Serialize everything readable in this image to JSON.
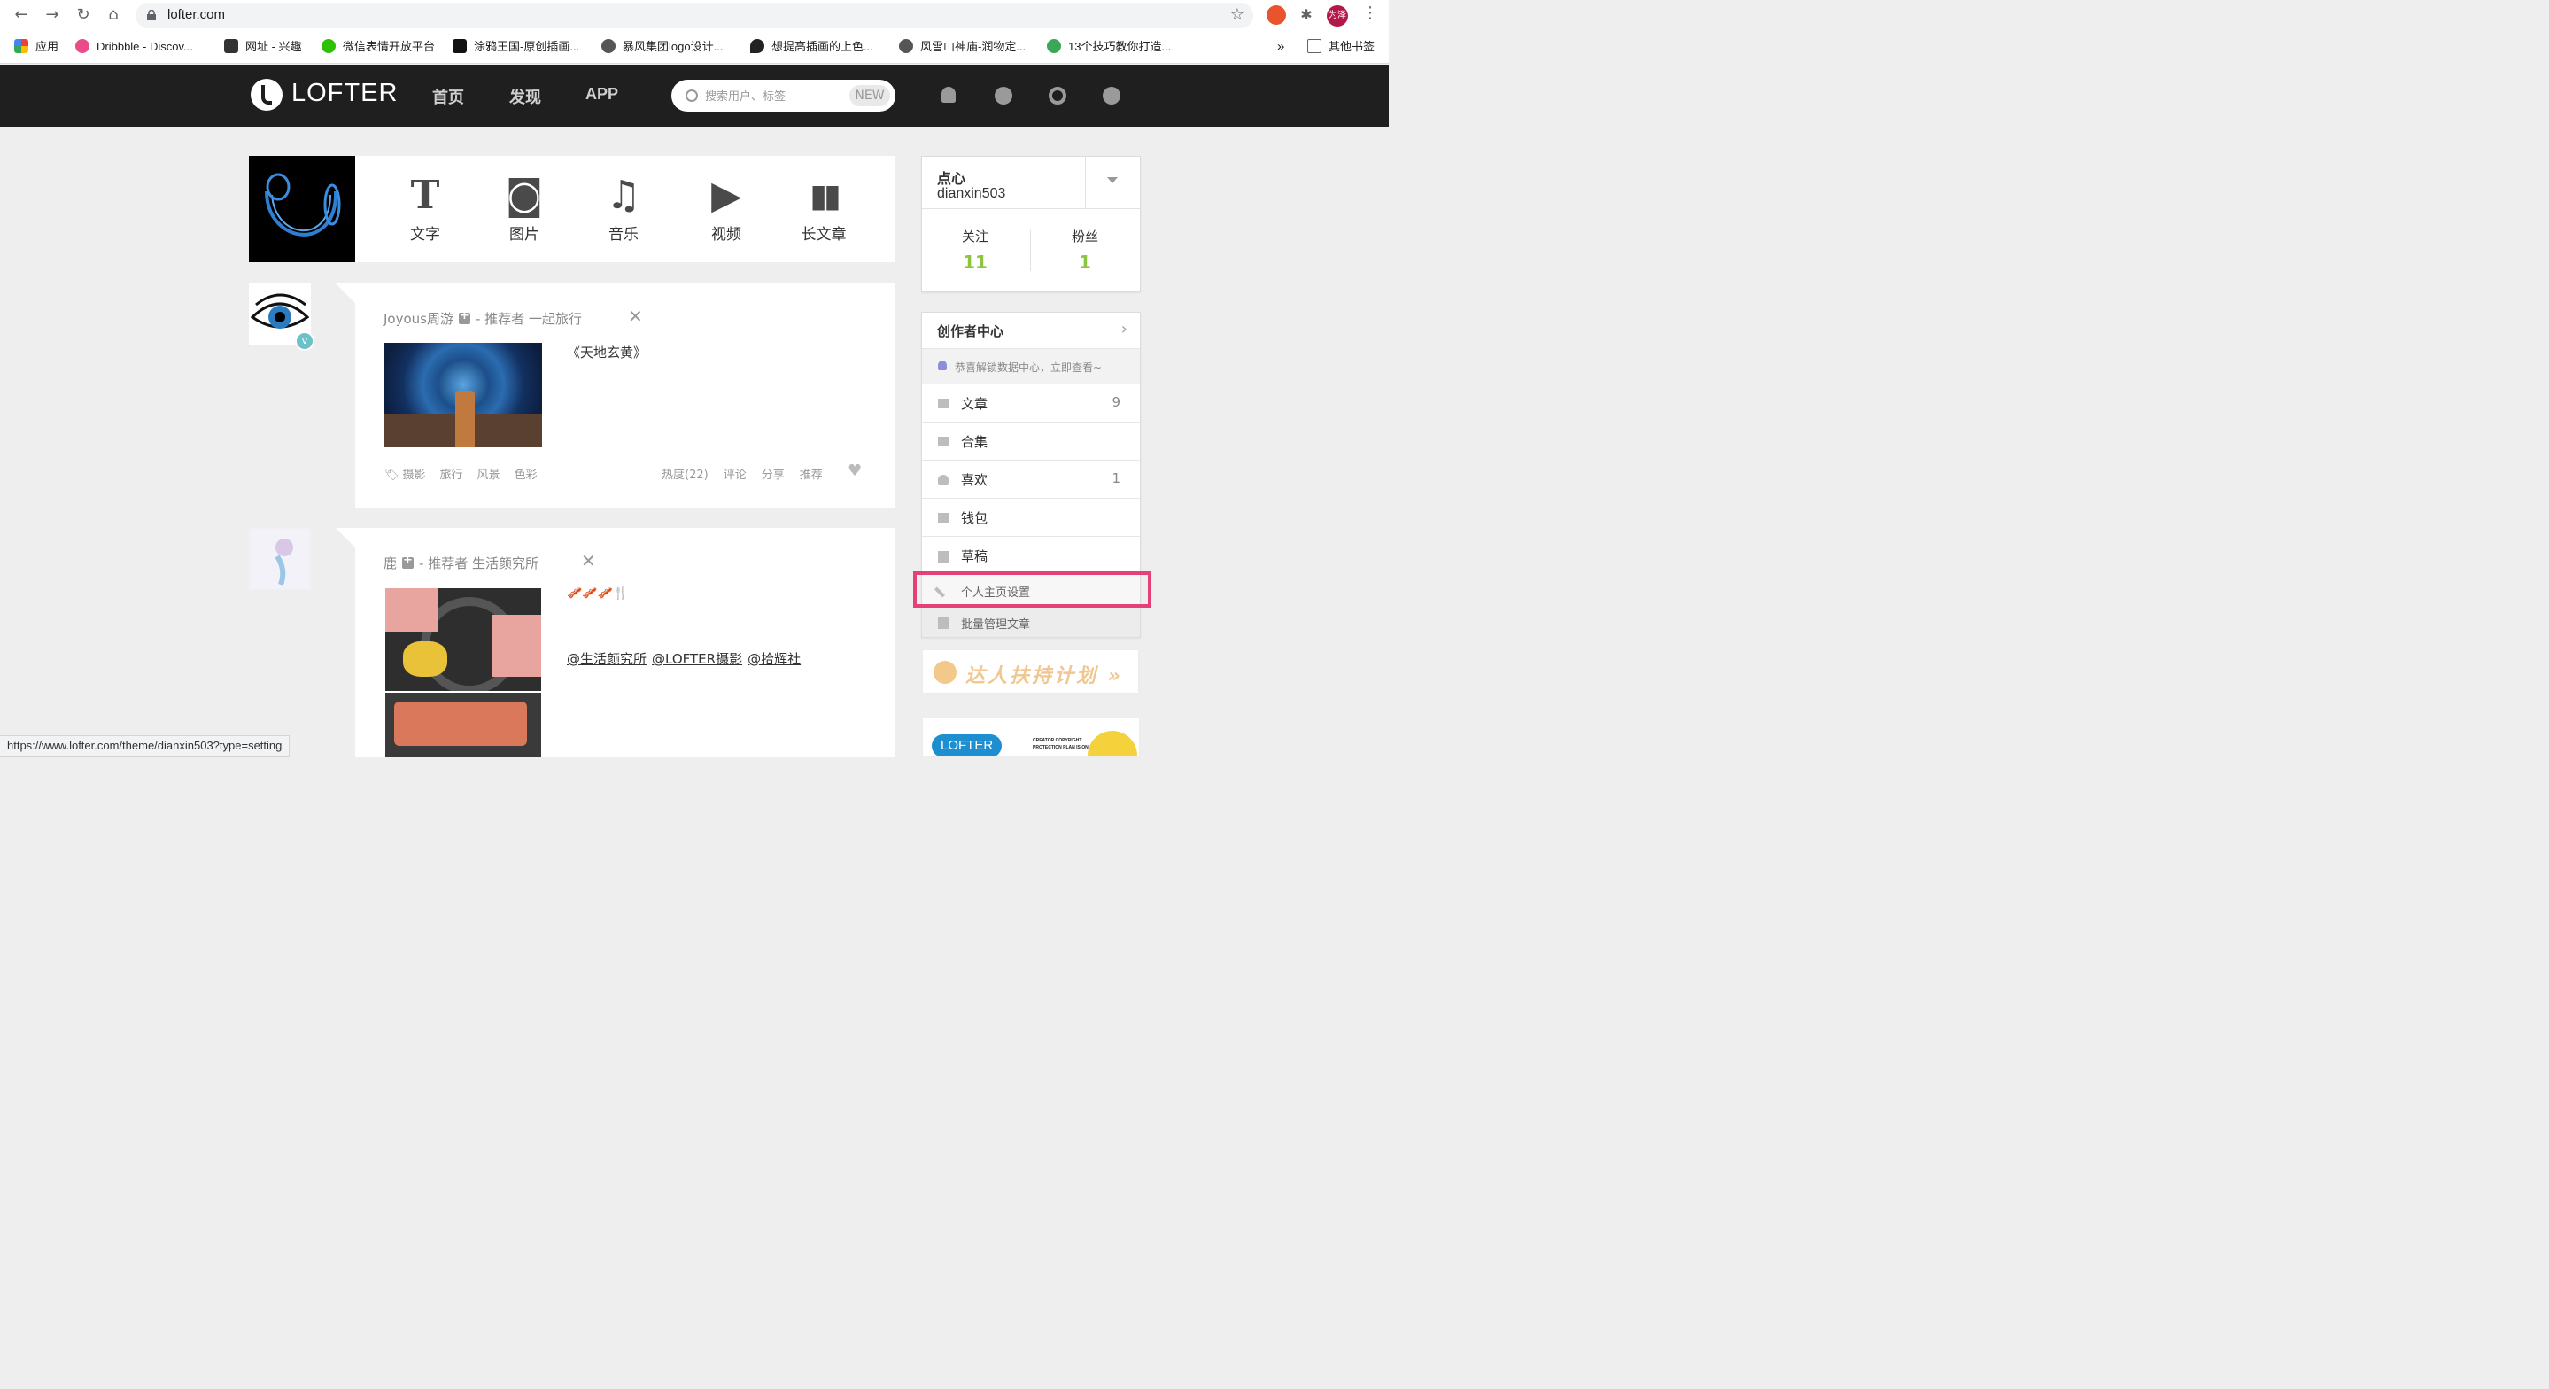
{
  "browser": {
    "url": "lofter.com",
    "status_url": "https://www.lofter.com/theme/dianxin503?type=setting",
    "profile_label": "为泽",
    "bookmarks": [
      {
        "label": "应用",
        "color": "#e84c3d"
      },
      {
        "label": "Dribbble - Discov...",
        "color": "#ea4c89"
      },
      {
        "label": "网址 - 兴趣",
        "color": "#333333"
      },
      {
        "label": "微信表情开放平台",
        "color": "#2dc100"
      },
      {
        "label": "涂鸦王国-原创插画...",
        "color": "#111111"
      },
      {
        "label": "暴风集团logo设计...",
        "color": "#555555"
      },
      {
        "label": "想提高插画的上色...",
        "color": "#222222"
      },
      {
        "label": "风雪山神庙-润物定...",
        "color": "#555555"
      },
      {
        "label": "13个技巧教你打造...",
        "color": "#3aa757"
      }
    ],
    "more_bookmarks": "»",
    "other_bookmarks": "其他书签"
  },
  "header": {
    "logo_text": "LOFTER",
    "nav": [
      "首页",
      "发现",
      "APP"
    ],
    "search_placeholder": "搜索用户、标签",
    "search_badge": "NEW"
  },
  "post_types": [
    {
      "label": "文字",
      "glyph": "T"
    },
    {
      "label": "图片",
      "glyph": "◙"
    },
    {
      "label": "音乐",
      "glyph": "♫"
    },
    {
      "label": "视频",
      "glyph": "▶"
    },
    {
      "label": "长文章",
      "glyph": "▮▮"
    }
  ],
  "posts": [
    {
      "author": "Joyous周游",
      "recommender_prefix": "- 推荐者",
      "recommender": "一起旅行",
      "title": "《天地玄黄》",
      "tags": [
        "摄影",
        "旅行",
        "风景",
        "色彩"
      ],
      "actions": [
        "热度(22)",
        "评论",
        "分享",
        "推荐"
      ]
    },
    {
      "author": "鹿",
      "recommender_prefix": "- 推荐者",
      "recommender": "生活颜究所",
      "emoji_line": "🥓🥓🥓🍴",
      "mentions": [
        "@生活颜究所",
        "@LOFTER摄影",
        "@拾辉社"
      ]
    }
  ],
  "profile": {
    "name": "点心",
    "username": "dianxin503",
    "following_label": "关注",
    "following_count": "11",
    "followers_label": "粉丝",
    "followers_count": "1"
  },
  "creator": {
    "title": "创作者中心",
    "notice": "恭喜解锁数据中心，立即查看~",
    "items": [
      {
        "label": "文章",
        "count": "9"
      },
      {
        "label": "合集",
        "count": ""
      },
      {
        "label": "喜欢",
        "count": "1"
      },
      {
        "label": "钱包",
        "count": ""
      },
      {
        "label": "草稿",
        "count": ""
      },
      {
        "label": "个人主页设置",
        "count": ""
      },
      {
        "label": "批量管理文章",
        "count": ""
      }
    ]
  },
  "banner": {
    "text": "达人扶持计划 »",
    "badge": "LOFTER",
    "small_text_1": "CREATOR COPYRIGHT",
    "small_text_2": "PROTECTION PLAN IS ONLINE"
  },
  "colors": {
    "accent_green": "#8cc63f",
    "highlight_pink": "#e6407a",
    "header_bg": "#1f1f1f"
  }
}
